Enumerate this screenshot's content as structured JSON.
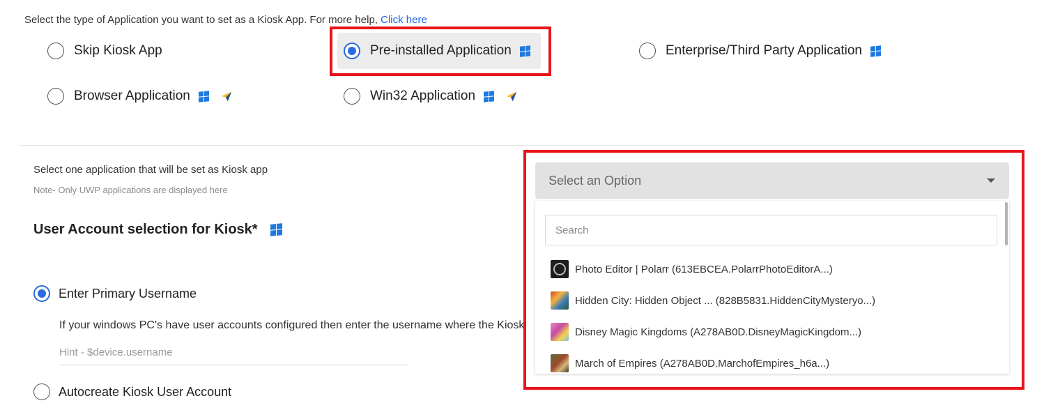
{
  "intro": {
    "text": "Select the type of Application you want to set as a Kiosk App. For more help, ",
    "link": "Click here"
  },
  "app_types": [
    {
      "label": "Skip Kiosk App",
      "selected": false
    },
    {
      "label": "Pre-installed Application",
      "selected": true
    },
    {
      "label": "Enterprise/Third Party Application",
      "selected": false
    },
    {
      "label": "Browser Application",
      "selected": false
    },
    {
      "label": "Win32 Application",
      "selected": false
    }
  ],
  "app_select": {
    "label": "Select one application that will be set as Kiosk app",
    "note": "Note- Only UWP applications are displayed here",
    "placeholder": "Select an Option",
    "search_placeholder": "Search",
    "options": [
      "Photo Editor | Polarr (613EBCEA.PolarrPhotoEditorA...)",
      "Hidden City: Hidden Object ... (828B5831.HiddenCityMysteryo...)",
      "Disney Magic Kingdoms (A278AB0D.DisneyMagicKingdom...)",
      "March of Empires (A278AB0D.MarchofEmpires_h6a...)"
    ]
  },
  "user_account": {
    "title": "User Account selection for Kiosk*",
    "primary_label": "Enter Primary Username",
    "primary_desc": "If your windows PC's have user accounts configured then enter the username where the Kiosk",
    "hint_placeholder": "Hint - $device.username",
    "autocreate_label": "Autocreate Kiosk User Account"
  },
  "colors": {
    "accent": "#2a6be0",
    "highlight": "#e8141b",
    "windows_icon": "#1e7ae0"
  }
}
